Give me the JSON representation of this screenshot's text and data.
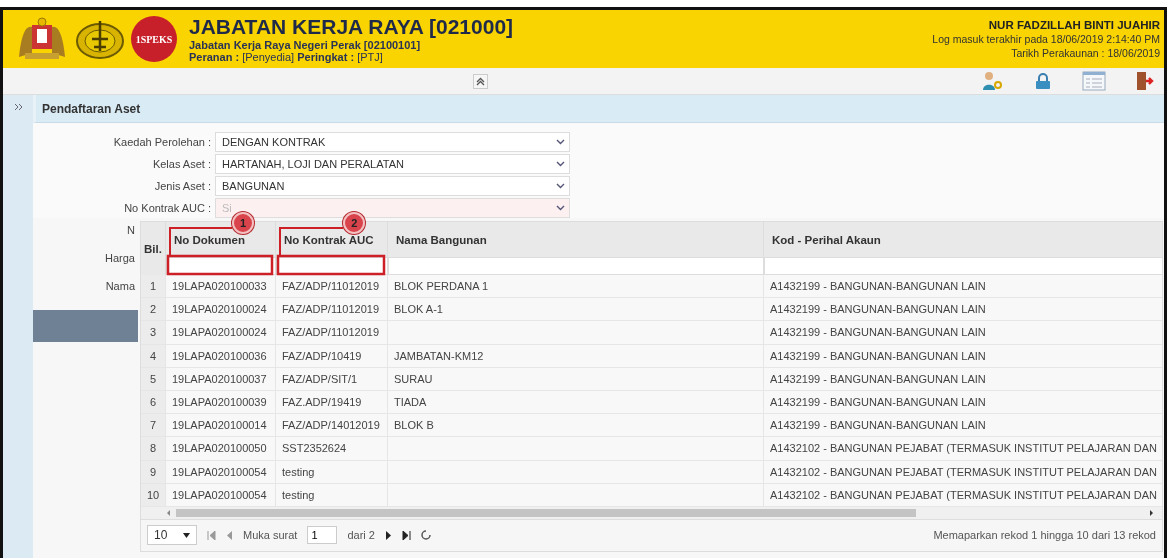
{
  "header": {
    "logo_text": "1SPEKS",
    "title": "JABATAN KERJA RAYA [021000]",
    "subtitle": "Jabatan Kerja Raya Negeri Perak [02100101]",
    "role": "**Peranan :** [Penyedia] **Peringkat :** [PTJ]",
    "user_name": "NUR FADZILLAH BINTI JUAHIR",
    "last_login": "Log masuk terakhir pada 18/06/2019 2:14:40 PM",
    "accounting_date": "Tarikh Perakaunan : 18/06/2019"
  },
  "panel": {
    "title": "Pendaftaran Aset"
  },
  "form": [
    {
      "label": "Kaedah Perolehan :",
      "value": "DENGAN KONTRAK",
      "invalid": false
    },
    {
      "label": "Kelas Aset :",
      "value": "HARTANAH, LOJI DAN PERALATAN",
      "invalid": false
    },
    {
      "label": "Jenis Aset :",
      "value": "BANGUNAN",
      "invalid": false
    },
    {
      "label": "No Kontrak AUC :",
      "placeholder": "Si",
      "invalid": true
    }
  ],
  "covered_labels": [
    "N",
    "Harga",
    "Nama"
  ],
  "grid": {
    "columns": [
      {
        "label": "Bil."
      },
      {
        "label": "No Dokumen",
        "callout": "1"
      },
      {
        "label": "No Kontrak AUC",
        "callout": "2"
      },
      {
        "label": "Nama Bangunan"
      },
      {
        "label": "Kod - Perihal Akaun"
      }
    ],
    "rows": [
      [
        "1",
        "19LAPA020100033",
        "FAZ/ADP/11012019",
        "BLOK PERDANA 1",
        "A1432199 - BANGUNAN-BANGUNAN LAIN"
      ],
      [
        "2",
        "19LAPA020100024",
        "FAZ/ADP/11012019",
        "BLOK A-1",
        "A1432199 - BANGUNAN-BANGUNAN LAIN"
      ],
      [
        "3",
        "19LAPA020100024",
        "FAZ/ADP/11012019",
        "",
        "A1432199 - BANGUNAN-BANGUNAN LAIN"
      ],
      [
        "4",
        "19LAPA020100036",
        "FAZ/ADP/10419",
        "JAMBATAN-KM12",
        "A1432199 - BANGUNAN-BANGUNAN LAIN"
      ],
      [
        "5",
        "19LAPA020100037",
        "FAZ/ADP/SIT/1",
        "SURAU",
        "A1432199 - BANGUNAN-BANGUNAN LAIN"
      ],
      [
        "6",
        "19LAPA020100039",
        "FAZ.ADP/19419",
        "TIADA",
        "A1432199 - BANGUNAN-BANGUNAN LAIN"
      ],
      [
        "7",
        "19LAPA020100014",
        "FAZ/ADP/14012019",
        "BLOK B",
        "A1432199 - BANGUNAN-BANGUNAN LAIN"
      ],
      [
        "8",
        "19LAPA020100050",
        "SST2352624",
        "",
        "A1432102 - BANGUNAN PEJABAT (TERMASUK INSTITUT PELAJARAN DAN"
      ],
      [
        "9",
        "19LAPA020100054",
        "testing",
        "",
        "A1432102 - BANGUNAN PEJABAT (TERMASUK INSTITUT PELAJARAN DAN"
      ],
      [
        "10",
        "19LAPA020100054",
        "testing",
        "",
        "A1432102 - BANGUNAN PEJABAT (TERMASUK INSTITUT PELAJARAN DAN"
      ]
    ],
    "pager": {
      "page_size": "10",
      "page_label": "Muka surat",
      "page": "1",
      "page_count": "dari 2",
      "status": "Memaparkan rekod 1 hingga 10 dari 13 rekod"
    }
  }
}
